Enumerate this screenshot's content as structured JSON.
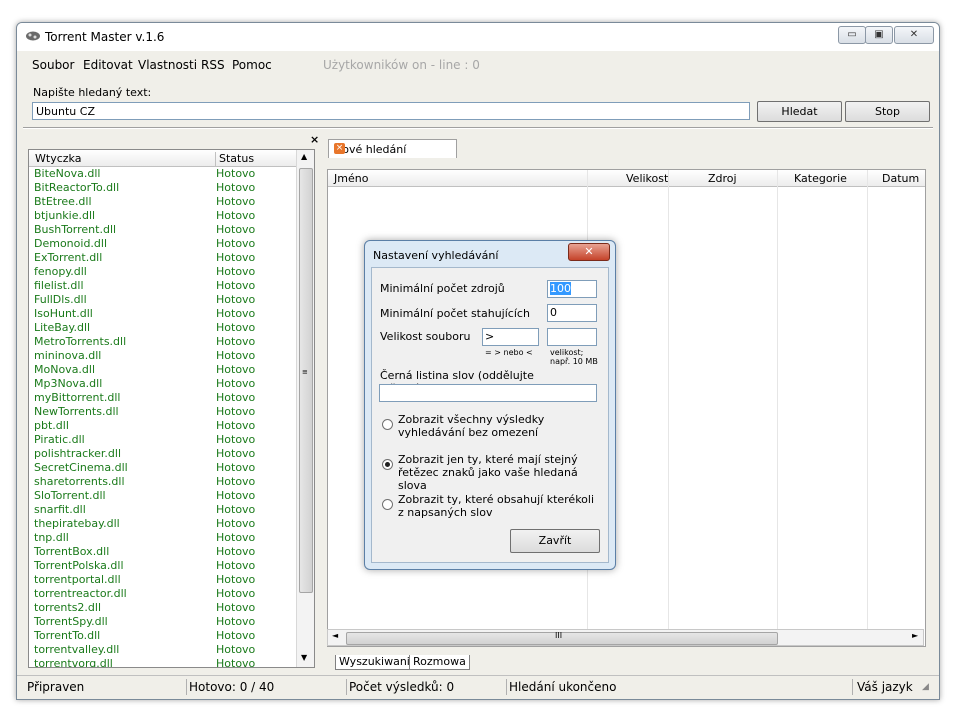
{
  "window": {
    "title": "Torrent Master v.1.6",
    "controls": {
      "minimize": "▭",
      "maximize": "▣",
      "close": "✕"
    }
  },
  "menu": {
    "items": [
      "Soubor",
      "Editovat",
      "Vlastnosti",
      "RSS",
      "Pomoc"
    ],
    "users_status": "Użytkowników on - line : 0"
  },
  "search": {
    "label": "Napište hledaný text:",
    "value": "Ubuntu CZ",
    "search_button": "Hledat",
    "stop_button": "Stop"
  },
  "plugins": {
    "columns": [
      "Wtyczka",
      "Status"
    ],
    "rows": [
      [
        "BiteNova.dll",
        "Hotovo"
      ],
      [
        "BitReactorTo.dll",
        "Hotovo"
      ],
      [
        "BtEtree.dll",
        "Hotovo"
      ],
      [
        "btjunkie.dll",
        "Hotovo"
      ],
      [
        "BushTorrent.dll",
        "Hotovo"
      ],
      [
        "Demonoid.dll",
        "Hotovo"
      ],
      [
        "ExTorrent.dll",
        "Hotovo"
      ],
      [
        "fenopy.dll",
        "Hotovo"
      ],
      [
        "filelist.dll",
        "Hotovo"
      ],
      [
        "FullDls.dll",
        "Hotovo"
      ],
      [
        "IsoHunt.dll",
        "Hotovo"
      ],
      [
        "LiteBay.dll",
        "Hotovo"
      ],
      [
        "MetroTorrents.dll",
        "Hotovo"
      ],
      [
        "mininova.dll",
        "Hotovo"
      ],
      [
        "MoNova.dll",
        "Hotovo"
      ],
      [
        "Mp3Nova.dll",
        "Hotovo"
      ],
      [
        "myBittorrent.dll",
        "Hotovo"
      ],
      [
        "NewTorrents.dll",
        "Hotovo"
      ],
      [
        "pbt.dll",
        "Hotovo"
      ],
      [
        "Piratic.dll",
        "Hotovo"
      ],
      [
        "polishtracker.dll",
        "Hotovo"
      ],
      [
        "SecretCinema.dll",
        "Hotovo"
      ],
      [
        "sharetorrents.dll",
        "Hotovo"
      ],
      [
        "SloTorrent.dll",
        "Hotovo"
      ],
      [
        "snarfit.dll",
        "Hotovo"
      ],
      [
        "thepiratebay.dll",
        "Hotovo"
      ],
      [
        "tnp.dll",
        "Hotovo"
      ],
      [
        "TorrentBox.dll",
        "Hotovo"
      ],
      [
        "TorrentPolska.dll",
        "Hotovo"
      ],
      [
        "torrentportal.dll",
        "Hotovo"
      ],
      [
        "torrentreactor.dll",
        "Hotovo"
      ],
      [
        "torrents2.dll",
        "Hotovo"
      ],
      [
        "TorrentSpy.dll",
        "Hotovo"
      ],
      [
        "TorrentTo.dll",
        "Hotovo"
      ],
      [
        "torrentvalley.dll",
        "Hotovo"
      ],
      [
        "torrentvorg.dll",
        "Hotovo"
      ]
    ]
  },
  "results": {
    "tab_label": "Nové hledání",
    "columns": [
      "Jméno",
      "Velikost",
      "Zdroj",
      "Kategorie",
      "Datum"
    ],
    "scroll_grip": "III"
  },
  "bottom_tabs": [
    "Wyszukiwanie",
    "Rozmowa"
  ],
  "status": {
    "ready": "Připraven",
    "done": "Hotovo: 0 / 40",
    "results": "Počet výsledků: 0",
    "search": "Hledání ukončeno",
    "language": "Váš jazyk :"
  },
  "dialog": {
    "title": "Nastavení vyhledávání",
    "close": "✕",
    "min_sources_label": "Minimální počet zdrojů",
    "min_sources_value": "100",
    "min_downloaders_label": "Minimální počet stahujících",
    "min_downloaders_value": "0",
    "file_size_label": "Velikost souboru",
    "size_operator": ">",
    "size_value": "",
    "operator_hint": "= > nebo <",
    "size_hint_1": "velikost;",
    "size_hint_2": "např. 10 MB",
    "blacklist_label": "Černá listina slov (oddělujte středníkem;):",
    "blacklist_value": "",
    "option_all": "Zobrazit všechny výsledky vyhledávání bez omezení",
    "option_exact": "Zobrazit jen ty, které mají stejný řetězec znaků jako vaše hledaná slova",
    "option_any": "Zobrazit ty, které obsahují kterékoli z napsaných slov",
    "close_button": "Zavřít"
  }
}
